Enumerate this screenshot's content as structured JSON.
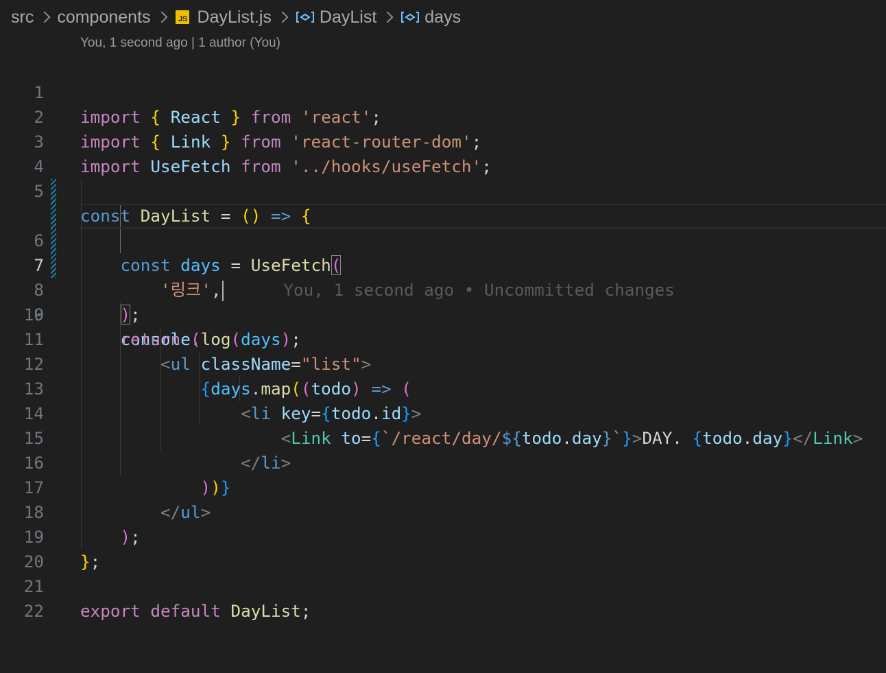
{
  "breadcrumb": {
    "items": [
      "src",
      "components",
      "DayList.js",
      "DayList",
      "days"
    ],
    "js_badge": "JS"
  },
  "blame_header": "You, 1 second ago | 1 author (You)",
  "editor": {
    "line_numbers": [
      "1",
      "2",
      "3",
      "4",
      "5",
      "6",
      "7",
      "8",
      "9",
      "10",
      "11",
      "12",
      "13",
      "14",
      "15",
      "16",
      "17",
      "18",
      "19",
      "20",
      "21",
      "22"
    ],
    "current_line": 7,
    "inline_blame": "You, 1 second ago • Uncommitted changes",
    "modified_lines": [
      6,
      7,
      8,
      9
    ],
    "tokens": {
      "import": "import",
      "from": "from",
      "lbrace": "{",
      "rbrace": "}",
      "react_ident": "React",
      "react_str": "'react'",
      "link_ident": "Link",
      "router_str": "'react-router-dom'",
      "usefetch_ident": "UseFetch",
      "hooks_str": "'../hooks/useFetch'",
      "semi": ";",
      "const": "const",
      "daylist": "DayList",
      "eq": "=",
      "lparen": "(",
      "rparen": ")",
      "arrow": "=>",
      "days": "days",
      "link_str": "'링크'",
      "comma": ",",
      "console": "console",
      "dot": ".",
      "log": "log",
      "return": "return",
      "lt": "<",
      "gt": ">",
      "ltslash": "</",
      "ul": "ul",
      "classname": "className",
      "list_str": "\"list\"",
      "map": "map",
      "todo": "todo",
      "li": "li",
      "key": "key",
      "id": "id",
      "to": "to",
      "backtick": "`",
      "path_str": "/react/day/",
      "dollar": "$",
      "day": "day",
      "day_text": "DAY. ",
      "export": "export",
      "default": "default"
    }
  },
  "colors": {
    "background": "#1f1f1f",
    "keyword": "#c586c0",
    "storage": "#569cd6",
    "string": "#ce9178",
    "variable": "#9cdcfe",
    "function": "#dcdcaa",
    "component": "#4ec9b0",
    "bracket_gold": "#ffd700",
    "bracket_orchid": "#da70d6",
    "bracket_blue": "#179fff",
    "modified_gutter": "#1b81a8"
  },
  "icons": {
    "file_icon": "javascript-file-icon",
    "symbol_icon": "symbol-variable-icon"
  }
}
